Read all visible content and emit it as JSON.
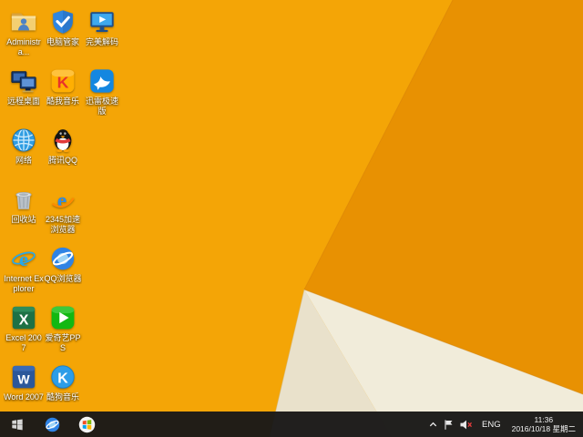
{
  "wallpaper": {
    "base": "#F4A506",
    "shade": "#E89102",
    "cream_light": "#F1ECDA",
    "cream_dark": "#E9E1CB",
    "edge": "#D8820A",
    "taskbar_color": "#1A1918"
  },
  "desktop": {
    "icons": [
      {
        "id": "administrator",
        "icon": "user-folder",
        "label": "Administra...",
        "col": 0,
        "row": 0
      },
      {
        "id": "remote-desktop",
        "icon": "remote-desktop",
        "label": "远程桌面",
        "col": 0,
        "row": 1
      },
      {
        "id": "network",
        "icon": "network",
        "label": "网络",
        "col": 0,
        "row": 2
      },
      {
        "id": "recycle-bin",
        "icon": "recycle-bin",
        "label": "回收站",
        "col": 0,
        "row": 3
      },
      {
        "id": "internet-explorer",
        "icon": "ie",
        "label": "Internet Explorer",
        "col": 0,
        "row": 4
      },
      {
        "id": "excel-2007",
        "icon": "excel",
        "label": "Excel 2007",
        "col": 0,
        "row": 5
      },
      {
        "id": "word-2007",
        "icon": "word",
        "label": "Word 2007",
        "col": 0,
        "row": 6
      },
      {
        "id": "pc-manager",
        "icon": "shield",
        "label": "电脑管家",
        "col": 1,
        "row": 0
      },
      {
        "id": "kuwo-music",
        "icon": "kuwo",
        "label": "酷我音乐",
        "col": 1,
        "row": 1
      },
      {
        "id": "tencent-qq",
        "icon": "qq",
        "label": "腾讯QQ",
        "col": 1,
        "row": 2
      },
      {
        "id": "2345-browser",
        "icon": "e2345",
        "label": "2345加速浏览器",
        "col": 1,
        "row": 3
      },
      {
        "id": "qq-browser",
        "icon": "qq-browser",
        "label": "QQ浏览器",
        "col": 1,
        "row": 4
      },
      {
        "id": "iqiyi-pps",
        "icon": "pps",
        "label": "爱奇艺PPS",
        "col": 1,
        "row": 5
      },
      {
        "id": "kugou-music",
        "icon": "kugou",
        "label": "酷狗音乐",
        "col": 1,
        "row": 6
      },
      {
        "id": "purecodec",
        "icon": "monitor-play",
        "label": "完美解码",
        "col": 2,
        "row": 0
      },
      {
        "id": "xunlei",
        "icon": "xunlei",
        "label": "迅雷极速版",
        "col": 2,
        "row": 1
      }
    ]
  },
  "taskbar": {
    "pinned": [
      {
        "id": "start",
        "icon": "win-flag"
      },
      {
        "id": "qq-browser",
        "icon": "qq-browser"
      },
      {
        "id": "windows-circle",
        "icon": "win-circle"
      }
    ],
    "tray": {
      "lang": "ENG",
      "time": "11:36",
      "date": "2016/10/18 星期二"
    }
  }
}
